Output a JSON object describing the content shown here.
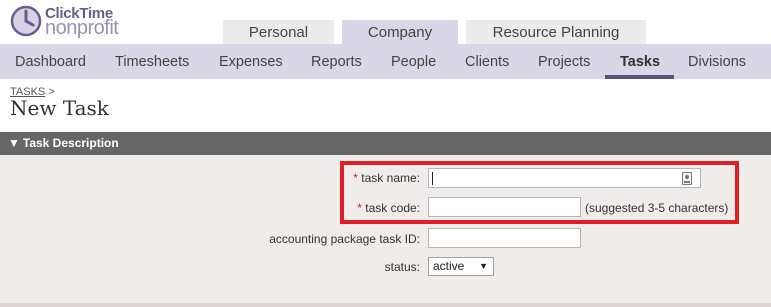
{
  "logo": {
    "line1": "ClickTime",
    "line2": "nonprofit"
  },
  "top_tabs": [
    {
      "label": "Personal",
      "active": false
    },
    {
      "label": "Company",
      "active": true
    },
    {
      "label": "Resource Planning",
      "active": false
    }
  ],
  "nav": [
    {
      "label": "Dashboard"
    },
    {
      "label": "Timesheets"
    },
    {
      "label": "Expenses"
    },
    {
      "label": "Reports"
    },
    {
      "label": "People"
    },
    {
      "label": "Clients"
    },
    {
      "label": "Projects"
    },
    {
      "label": "Tasks",
      "active": true
    },
    {
      "label": "Divisions"
    }
  ],
  "breadcrumb": {
    "link": "TASKS",
    "sep": ">"
  },
  "page_title": "New Task",
  "section": {
    "arrow": "▼",
    "title": "Task Description"
  },
  "form": {
    "task_name": {
      "required_mark": "*",
      "label": "task name:",
      "value": ""
    },
    "task_code": {
      "required_mark": "*",
      "label": "task code:",
      "value": "",
      "hint": "(suggested 3-5 characters)"
    },
    "accounting_id": {
      "label": "accounting package task ID:",
      "value": ""
    },
    "status": {
      "label": "status:",
      "value": "active",
      "arrow": "▼"
    }
  },
  "colors": {
    "highlight": "#e01e25",
    "nav_bg": "#d9d6e6",
    "section_bg": "#666666",
    "form_bg": "#f0ecea"
  }
}
